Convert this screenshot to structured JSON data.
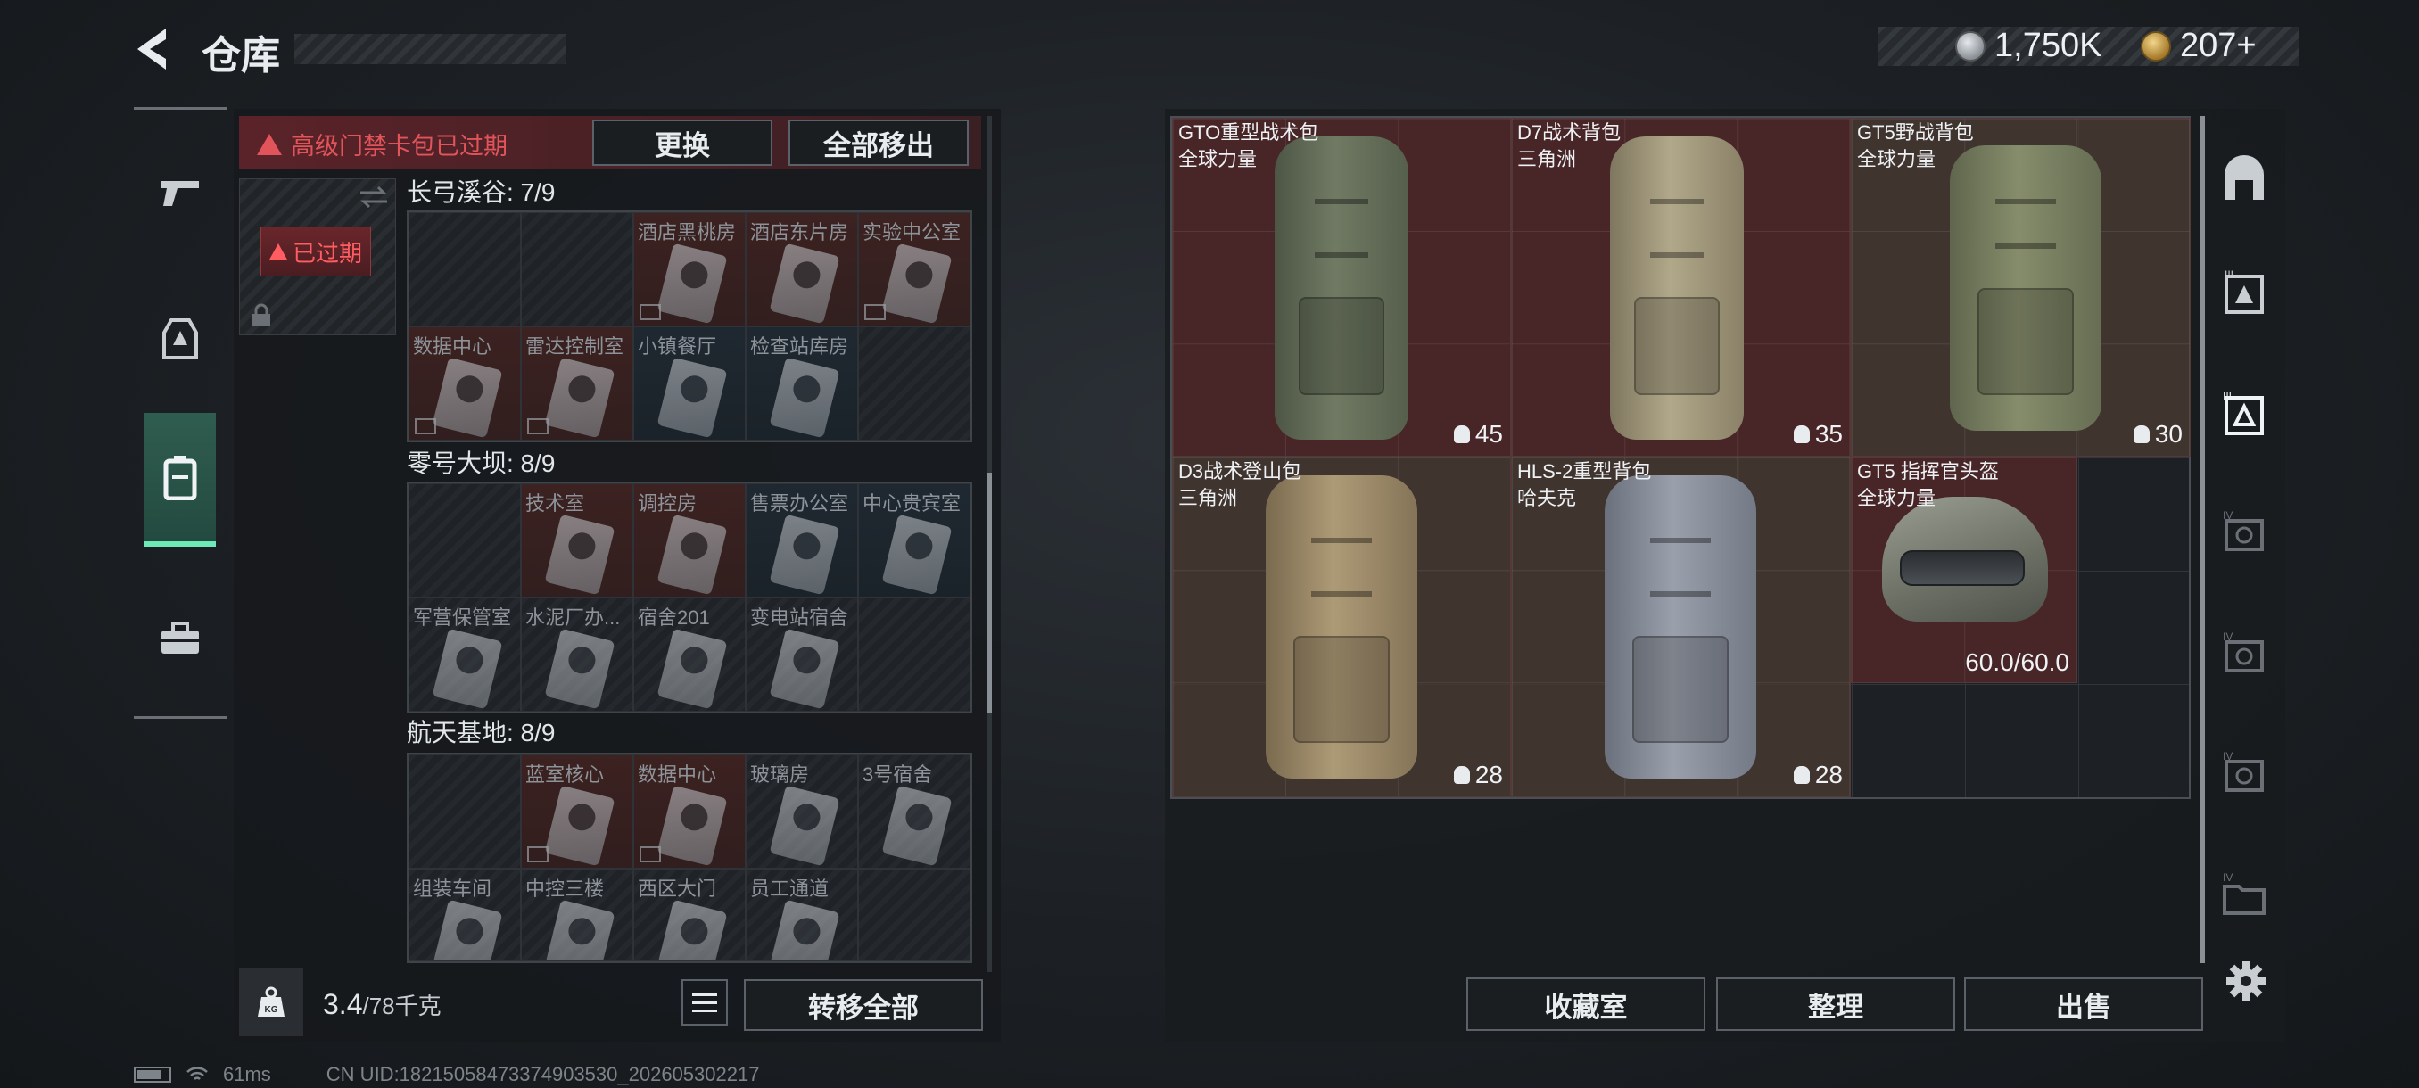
{
  "header": {
    "title": "仓库",
    "currency_silver": "1,750K",
    "currency_gold": "207+"
  },
  "left_nav": {
    "items": [
      "weapon",
      "armor",
      "backpack",
      "toolbox"
    ],
    "active": "backpack"
  },
  "card_pack": {
    "warning": "高级门禁卡包已过期",
    "replace_label": "更换",
    "remove_all_label": "全部移出",
    "expired_label": "已过期"
  },
  "sections": [
    {
      "title": "长弓溪谷: 7/9",
      "cells": [
        {
          "label": "",
          "card": false,
          "tone": "dark",
          "nolink": false
        },
        {
          "label": "",
          "card": false,
          "tone": "dark",
          "nolink": false
        },
        {
          "label": "酒店黑桃房",
          "card": true,
          "tone": "red",
          "nolink": true
        },
        {
          "label": "酒店东片房",
          "card": true,
          "tone": "red",
          "nolink": false
        },
        {
          "label": "实验中公室",
          "card": true,
          "tone": "red",
          "nolink": true
        },
        {
          "label": "数据中心",
          "card": true,
          "tone": "red",
          "nolink": true
        },
        {
          "label": "雷达控制室",
          "card": true,
          "tone": "red",
          "nolink": true
        },
        {
          "label": "小镇餐厅",
          "card": true,
          "tone": "blue",
          "nolink": false
        },
        {
          "label": "检查站库房",
          "card": true,
          "tone": "blue",
          "nolink": false
        },
        {
          "label": "",
          "card": false,
          "tone": "dark",
          "nolink": false
        }
      ]
    },
    {
      "title": "零号大坝: 8/9",
      "cells": [
        {
          "label": "",
          "card": false,
          "tone": "dark",
          "nolink": false
        },
        {
          "label": "技术室",
          "card": true,
          "tone": "red",
          "nolink": false
        },
        {
          "label": "调控房",
          "card": true,
          "tone": "red",
          "nolink": false
        },
        {
          "label": "售票办公室",
          "card": true,
          "tone": "blue",
          "nolink": false
        },
        {
          "label": "中心贵宾室",
          "card": true,
          "tone": "blue",
          "nolink": false
        },
        {
          "label": "军营保管室",
          "card": true,
          "tone": "dark",
          "nolink": false
        },
        {
          "label": "水泥厂办...",
          "card": true,
          "tone": "dark",
          "nolink": false
        },
        {
          "label": "宿舍201",
          "card": true,
          "tone": "dark",
          "nolink": false
        },
        {
          "label": "变电站宿舍",
          "card": true,
          "tone": "dark",
          "nolink": false
        },
        {
          "label": "",
          "card": false,
          "tone": "dark",
          "nolink": false
        }
      ]
    },
    {
      "title": "航天基地: 8/9",
      "cells": [
        {
          "label": "",
          "card": false,
          "tone": "dark",
          "nolink": false
        },
        {
          "label": "蓝室核心",
          "card": true,
          "tone": "red",
          "nolink": true
        },
        {
          "label": "数据中心",
          "card": true,
          "tone": "red",
          "nolink": true
        },
        {
          "label": "玻璃房",
          "card": true,
          "tone": "dark",
          "nolink": false
        },
        {
          "label": "3号宿舍",
          "card": true,
          "tone": "dark",
          "nolink": false
        },
        {
          "label": "组装车间",
          "card": true,
          "tone": "dark",
          "nolink": false
        },
        {
          "label": "中控三楼",
          "card": true,
          "tone": "dark",
          "nolink": false
        },
        {
          "label": "西区大门",
          "card": true,
          "tone": "dark",
          "nolink": false
        },
        {
          "label": "员工通道",
          "card": true,
          "tone": "dark",
          "nolink": false
        },
        {
          "label": "",
          "card": false,
          "tone": "dark",
          "nolink": false
        }
      ]
    }
  ],
  "weight": {
    "current": "3.4",
    "max": "/78千克"
  },
  "transfer_all_label": "转移全部",
  "items": [
    {
      "name": "GTO重型战术包",
      "sub": "全球力量",
      "cap": "45",
      "tone": "red",
      "color": "#6f7a63"
    },
    {
      "name": "D7战术背包",
      "sub": "三角洲",
      "cap": "35",
      "tone": "red",
      "color": "#a39a7e"
    },
    {
      "name": "GT5野战背包",
      "sub": "全球力量",
      "cap": "30",
      "tone": "brown",
      "color": "#7d8466"
    },
    {
      "name": "D3战术登山包",
      "sub": "三角洲",
      "cap": "28",
      "tone": "brown",
      "color": "#a08a68"
    },
    {
      "name": "HLS-2重型背包",
      "sub": "哈夫克",
      "cap": "28",
      "tone": "brown",
      "color": "#8a909c"
    },
    {
      "name": "GT5 指挥官头盔",
      "sub": "全球力量",
      "durability": "60.0/60.0",
      "tone": "red",
      "color": "#7f8378"
    }
  ],
  "bottom_buttons": {
    "collection": "收藏室",
    "organize": "整理",
    "sell": "出售"
  },
  "footer": {
    "ping": "61ms",
    "uid": "CN UID:18215058473374903530_202605302217"
  }
}
